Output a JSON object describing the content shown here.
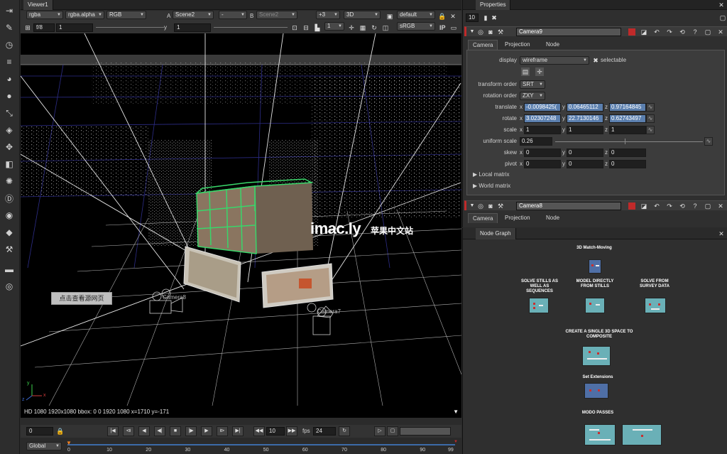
{
  "toolbar": {
    "icons": [
      "select-icon",
      "pencil-icon",
      "clock-icon",
      "bars-icon",
      "palette-icon",
      "circle-icon",
      "transform-icon",
      "layers-icon",
      "move-icon",
      "cube-icon",
      "particles-icon",
      "d-icon",
      "eye-icon",
      "tag-icon",
      "tools-icon",
      "film-icon",
      "nuke-icon"
    ]
  },
  "viewer": {
    "tab_label": "Viewer1",
    "row1": {
      "channels": "rgba",
      "alpha": "rgba.alpha",
      "colorspace": "RGB",
      "a_label": "A",
      "a_input": "Scene2",
      "blend": "-",
      "b_label": "B",
      "b_input": "Scene2",
      "exposure": "+3",
      "view_mode": "3D",
      "camera": "default"
    },
    "row2": {
      "fstop": "f/8",
      "gain": "1",
      "y_label": "y",
      "gamma": "1",
      "frame_field": "1",
      "lut": "sRGB",
      "ip_label": "IP"
    },
    "info": "HD 1080 1920x1080 bbox: 0 0 1920 1080 x=1710 y=-171",
    "playback": {
      "frame": "0",
      "step": "10",
      "fps_label": "fps",
      "fps": "24",
      "range": "Global"
    },
    "timeline_ticks": [
      "0",
      "10",
      "20",
      "30",
      "40",
      "50",
      "60",
      "70",
      "80",
      "90",
      "99"
    ],
    "camera_labels": [
      "Camera8",
      "Camera7"
    ],
    "overlay_link": "点击查看源网页",
    "axis_y": "y",
    "axis_x": "x",
    "axis_z": "z"
  },
  "watermark": {
    "brand": "imac.ly",
    "cn": "苹果中文站"
  },
  "properties": {
    "tab_label": "Properties",
    "max_panels": "10",
    "node1": {
      "name": "Camera9",
      "tabs": [
        "Camera",
        "Projection",
        "Node"
      ],
      "display_label": "display",
      "display_value": "wireframe",
      "selectable_label": "selectable",
      "transform_order_label": "transform order",
      "transform_order_value": "SRT",
      "rotation_order_label": "rotation order",
      "rotation_order_value": "ZXY",
      "translate_label": "translate",
      "translate": [
        "-0.0098425(",
        "0.06465112",
        "0.97164845"
      ],
      "rotate_label": "rotate",
      "rotate": [
        "3.02307248",
        "22.7130146",
        "0.62743497"
      ],
      "scale_label": "scale",
      "scale": [
        "1",
        "1",
        "1"
      ],
      "uniform_scale_label": "uniform scale",
      "uniform_scale": "0.26",
      "skew_label": "skew",
      "skew": [
        "0",
        "0",
        "0"
      ],
      "pivot_label": "pivot",
      "pivot": [
        "0",
        "0",
        "0"
      ],
      "local_matrix": "Local matrix",
      "world_matrix": "World matrix"
    },
    "node2": {
      "name": "Camera8",
      "tabs": [
        "Camera",
        "Projection",
        "Node"
      ]
    }
  },
  "nodegraph": {
    "tab_label": "Node Graph",
    "cards": [
      {
        "title": "3D Match-Moving"
      },
      {
        "title": "SOLVE STILLS AS WELL AS SEQUENCES"
      },
      {
        "title": "MODEL DIRECTLY FROM STILLS"
      },
      {
        "title": "SOLVE FROM SURVEY DATA"
      },
      {
        "title": "CREATE A SINGLE 3D SPACE TO COMPOSITE"
      },
      {
        "title": "Set Extensions"
      },
      {
        "title": "MODO PASSES"
      }
    ]
  },
  "colors": {
    "wireframe_green": "#39d66a",
    "grid_blue": "#2d2d88",
    "link_blue": "#5b7fae",
    "node_red": "#c02a2a",
    "thumb_teal": "#6ab0b7"
  }
}
